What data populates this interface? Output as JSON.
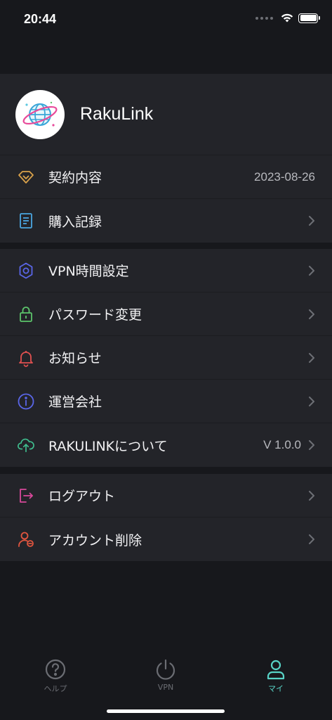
{
  "status_bar": {
    "time": "20:44"
  },
  "profile": {
    "name": "RakuLink",
    "avatar_icon": "globe-logo-icon"
  },
  "section1": [
    {
      "label": "契約内容",
      "value": "2023-08-26",
      "icon": "diamond-icon",
      "icon_color": "#d9a24a"
    },
    {
      "label": "購入記録",
      "icon": "document-icon",
      "icon_color": "#4aa6e0"
    }
  ],
  "section2": [
    {
      "label": "VPN時間設定",
      "icon": "gear-icon",
      "icon_color": "#5a66e8"
    },
    {
      "label": "パスワード変更",
      "icon": "lock-icon",
      "icon_color": "#5cc36b"
    },
    {
      "label": "お知らせ",
      "icon": "bell-icon",
      "icon_color": "#e05050"
    },
    {
      "label": "運営会社",
      "icon": "info-icon",
      "icon_color": "#5a66e8"
    },
    {
      "label": "RAKULINKについて",
      "value": "V 1.0.0",
      "icon": "cloud-upload-icon",
      "icon_color": "#3fbf8f"
    }
  ],
  "section3": [
    {
      "label": "ログアウト",
      "icon": "logout-icon",
      "icon_color": "#d8489a"
    },
    {
      "label": "アカウント削除",
      "icon": "user-delete-icon",
      "icon_color": "#e0553f"
    }
  ],
  "tabbar": {
    "items": [
      {
        "label": "ヘルプ",
        "icon": "help-icon"
      },
      {
        "label": "VPN",
        "icon": "power-icon"
      },
      {
        "label": "マイ",
        "icon": "person-icon",
        "active": true
      }
    ],
    "active_color": "#58d3c6",
    "inactive_color": "#6b6d73"
  },
  "colors": {
    "background": "#17181c",
    "card": "#232429",
    "chevron": "#6d6f75"
  }
}
